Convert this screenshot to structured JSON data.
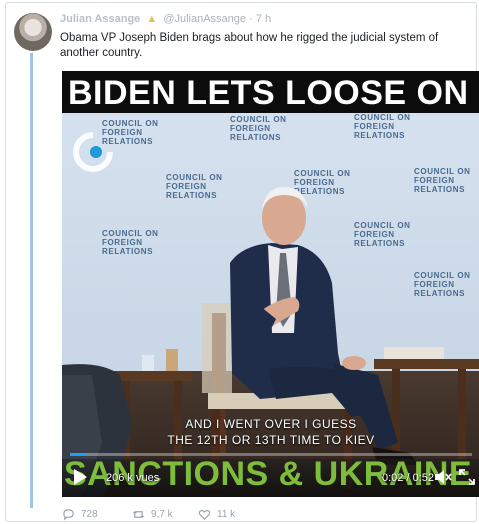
{
  "tweet": {
    "author_name": "Julian Assange",
    "author_handle": "@JulianAssange",
    "age": "7 h",
    "text": "Obama VP Joseph Biden brags about how he rigged the judicial system of another country."
  },
  "video": {
    "banner_text": "BIDEN LETS LOOSE ON",
    "backdrop_label_small": "COUNCIL ON",
    "backdrop_label_line1": "FOREIGN",
    "backdrop_label_line2": "RELATIONS",
    "caption_line1": "AND I WENT OVER I GUESS",
    "caption_line2": "THE 12TH OR 13TH TIME TO KIEV",
    "lower_title": "SANCTIONS & UKRAINE",
    "views": "206 k vues",
    "time": "0:02 / 0:52",
    "progress_fraction": 0.04,
    "accent_color": "#1da1f2",
    "lower_title_color": "#7ebd3c"
  },
  "actions": {
    "reply_count": "728",
    "retweet_count": "9,7 k",
    "like_count": "11 k"
  }
}
